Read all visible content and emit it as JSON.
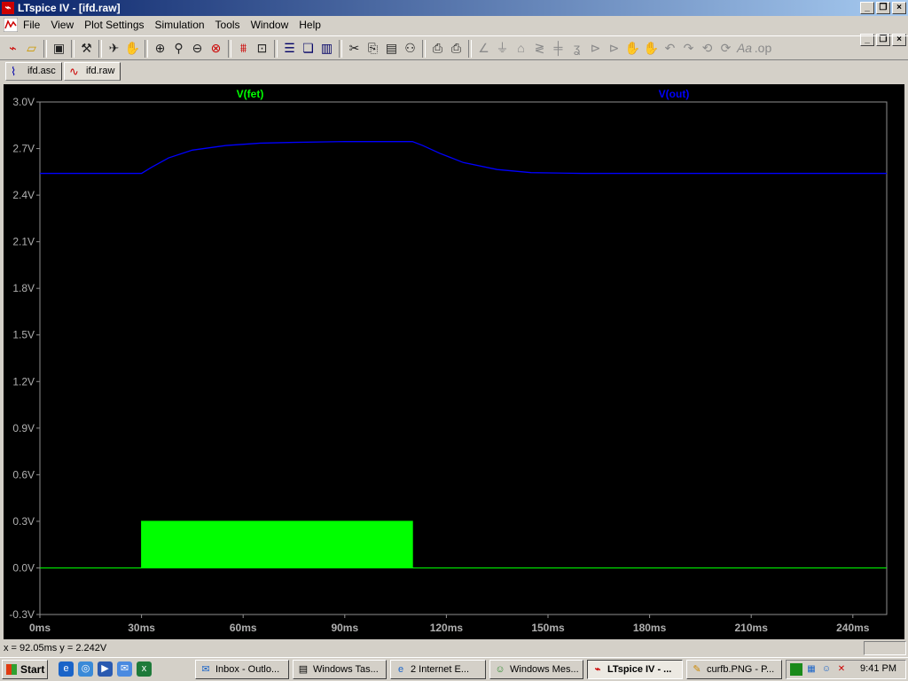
{
  "window": {
    "title": "LTspice IV - [ifd.raw]",
    "app_icon": "ltspice-icon"
  },
  "menu": [
    "File",
    "View",
    "Plot Settings",
    "Simulation",
    "Tools",
    "Window",
    "Help"
  ],
  "tabs": [
    {
      "label": "ifd.asc",
      "icon": "schematic-icon",
      "active": false
    },
    {
      "label": "ifd.raw",
      "icon": "waveform-icon",
      "active": true
    }
  ],
  "chart_data": {
    "type": "line",
    "series": [
      {
        "name": "V(fet)",
        "color": "#00ff00",
        "points": [
          [
            0,
            0
          ],
          [
            30,
            0
          ],
          [
            30,
            0.3
          ],
          [
            110,
            0.3
          ],
          [
            110,
            0
          ],
          [
            250,
            0
          ]
        ]
      },
      {
        "name": "V(out)",
        "color": "#0000ff",
        "points": [
          [
            0,
            2.54
          ],
          [
            30,
            2.54
          ],
          [
            33,
            2.58
          ],
          [
            38,
            2.64
          ],
          [
            45,
            2.69
          ],
          [
            55,
            2.72
          ],
          [
            65,
            2.735
          ],
          [
            75,
            2.74
          ],
          [
            90,
            2.745
          ],
          [
            110,
            2.745
          ],
          [
            113,
            2.72
          ],
          [
            118,
            2.67
          ],
          [
            125,
            2.61
          ],
          [
            135,
            2.565
          ],
          [
            145,
            2.545
          ],
          [
            160,
            2.54
          ],
          [
            250,
            2.54
          ]
        ]
      }
    ],
    "xlim": [
      0,
      250
    ],
    "ylim": [
      -0.3,
      3.0
    ],
    "x_ticks": [
      "0ms",
      "30ms",
      "60ms",
      "90ms",
      "120ms",
      "150ms",
      "180ms",
      "210ms",
      "240ms"
    ],
    "x_tick_values": [
      0,
      30,
      60,
      90,
      120,
      150,
      180,
      210,
      240
    ],
    "y_ticks": [
      "3.0V",
      "2.7V",
      "2.4V",
      "2.1V",
      "1.8V",
      "1.5V",
      "1.2V",
      "0.9V",
      "0.6V",
      "0.3V",
      "0.0V",
      "-0.3V"
    ],
    "y_tick_values": [
      3.0,
      2.7,
      2.4,
      2.1,
      1.8,
      1.5,
      1.2,
      0.9,
      0.6,
      0.3,
      0.0,
      -0.3
    ],
    "grid": false
  },
  "statusbar": {
    "cursor": "x = 92.05ms    y = 2.242V"
  },
  "taskbar": {
    "start": "Start",
    "tasks": [
      {
        "label": "Inbox - Outlo...",
        "icon": "outlook-icon",
        "active": false
      },
      {
        "label": "Windows Tas...",
        "icon": "task-manager-icon",
        "active": false
      },
      {
        "label": "2 Internet E...",
        "icon": "internet-explorer-icon",
        "active": false
      },
      {
        "label": "Windows Mes...",
        "icon": "messenger-icon",
        "active": false
      },
      {
        "label": "LTspice IV - ...",
        "icon": "ltspice-icon",
        "active": true
      },
      {
        "label": "curfb.PNG - P...",
        "icon": "paint-icon",
        "active": false
      }
    ],
    "clock": "9:41 PM"
  }
}
